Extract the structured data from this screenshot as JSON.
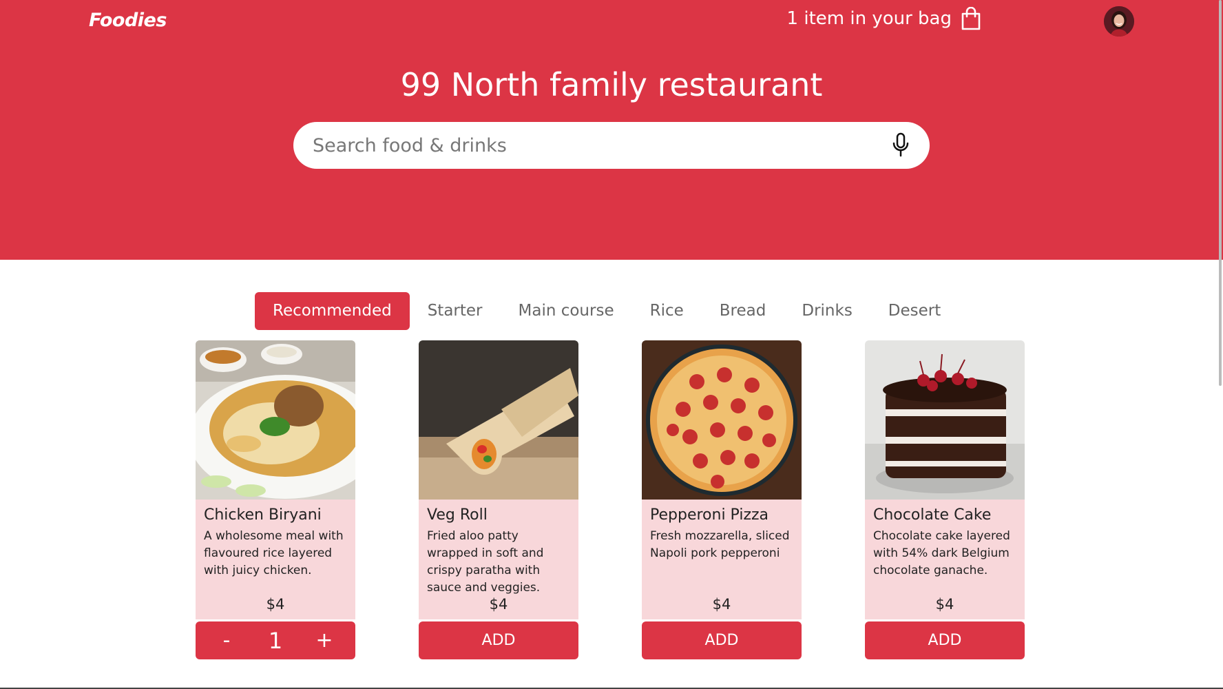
{
  "brand": {
    "logo": "Foodies",
    "accent": "#dc3545",
    "card_bg": "#f8d7da"
  },
  "header": {
    "bag_text": "1 item in your bag",
    "bag_icon": "shopping-bag-icon",
    "avatar_icon": "user-avatar"
  },
  "restaurant": {
    "title": "99 North family restaurant"
  },
  "search": {
    "placeholder": "Search food & drinks",
    "value": "",
    "mic_icon": "microphone-icon"
  },
  "tabs": [
    {
      "label": "Recommended",
      "active": true
    },
    {
      "label": "Starter",
      "active": false
    },
    {
      "label": "Main course",
      "active": false
    },
    {
      "label": "Rice",
      "active": false
    },
    {
      "label": "Bread",
      "active": false
    },
    {
      "label": "Drinks",
      "active": false
    },
    {
      "label": "Desert",
      "active": false
    }
  ],
  "items": [
    {
      "name": "Chicken Biryani",
      "description": "A wholesome meal with flavoured rice layered with juicy chicken.",
      "price": "$4",
      "in_bag": true,
      "quantity": "1",
      "minus": "-",
      "plus": "+"
    },
    {
      "name": "Veg Roll",
      "description": "Fried aloo patty wrapped in soft and crispy paratha with sauce and veggies.",
      "price": "$4",
      "in_bag": false,
      "button": "ADD"
    },
    {
      "name": "Pepperoni Pizza",
      "description": "Fresh mozzarella, sliced Napoli pork pepperoni",
      "price": "$4",
      "in_bag": false,
      "button": "ADD"
    },
    {
      "name": "Chocolate Cake",
      "description": "Chocolate cake layered with 54% dark Belgium chocolate ganache.",
      "price": "$4",
      "in_bag": false,
      "button": "ADD"
    }
  ]
}
